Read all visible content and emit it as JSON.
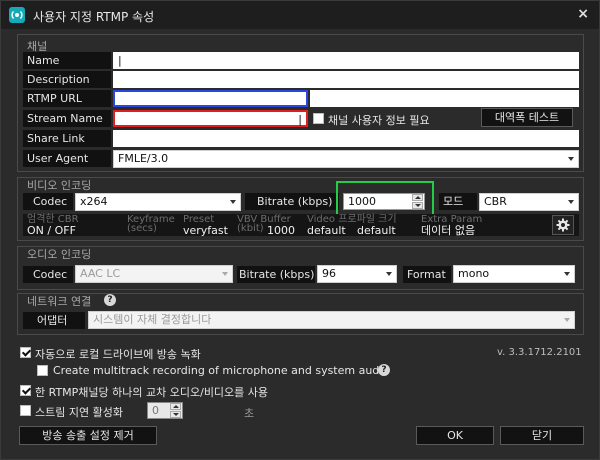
{
  "window": {
    "title": "사용자 지정 RTMP 속성",
    "close_label": "×"
  },
  "channel": {
    "group_label": "채널",
    "name_label": "Name",
    "name_value": "|",
    "description_label": "Description",
    "description_value": "",
    "rtmp_url_label": "RTMP URL",
    "rtmp_url_value": "",
    "stream_name_label": "Stream Name",
    "stream_name_value": "|",
    "user_info_checkbox_label": "채널 사용자 정보 필요",
    "user_info_checked": false,
    "bandwidth_test_label": "대역폭 테스트",
    "share_link_label": "Share Link",
    "share_link_value": "",
    "user_agent_label": "User Agent",
    "user_agent_value": "FMLE/3.0"
  },
  "video": {
    "group_label": "비디오 인코딩",
    "codec_label": "Codec",
    "codec_value": "x264",
    "bitrate_label": "Bitrate (kbps)",
    "bitrate_value": "1000",
    "mode_label": "모드",
    "mode_value": "CBR",
    "columns": [
      {
        "header": "엄격한 CBR",
        "value": "ON / OFF"
      },
      {
        "header": "Keyframe (secs)",
        "value": ""
      },
      {
        "header": "Preset",
        "value": "veryfast"
      },
      {
        "header": "VBV Buffer (kbit)",
        "value": "1000"
      },
      {
        "header": "Video 프로파일 크기",
        "value": "default"
      },
      {
        "header": "Extra Param",
        "value": "default"
      },
      {
        "header": "",
        "value": "데이터 없음"
      }
    ]
  },
  "audio": {
    "group_label": "오디오 인코딩",
    "codec_label": "Codec",
    "codec_value": "AAC LC",
    "bitrate_label": "Bitrate (kbps)",
    "bitrate_value": "96",
    "format_label": "Format",
    "format_value": "mono"
  },
  "network": {
    "group_label": "네트워크 연결",
    "adapter_label": "어댑터",
    "adapter_value": "시스템이 자체 결정합니다"
  },
  "options": {
    "local_record_label": "자동으로 로컬 드라이브에 방송 녹화",
    "local_record_checked": true,
    "multitrack_label": "Create multitrack recording of microphone and system audio",
    "multitrack_checked": false,
    "cross_av_label": "한 RTMP채널당 하나의 교차 오디오/비디오를 사용",
    "cross_av_checked": true,
    "stream_delay_label": "스트림 지연 활성화",
    "stream_delay_checked": false,
    "delay_value": "0",
    "delay_unit": "초"
  },
  "version": "v. 3.3.1712.2101",
  "buttons": {
    "remove_label": "방송 송출 설정 제거",
    "ok_label": "OK",
    "close_label": "닫기"
  },
  "colors": {
    "rtmp_url_border": "#2a46e0",
    "stream_name_border": "#e02020",
    "bitrate_highlight": "#22cc44",
    "app_icon": "#16a9b8"
  }
}
